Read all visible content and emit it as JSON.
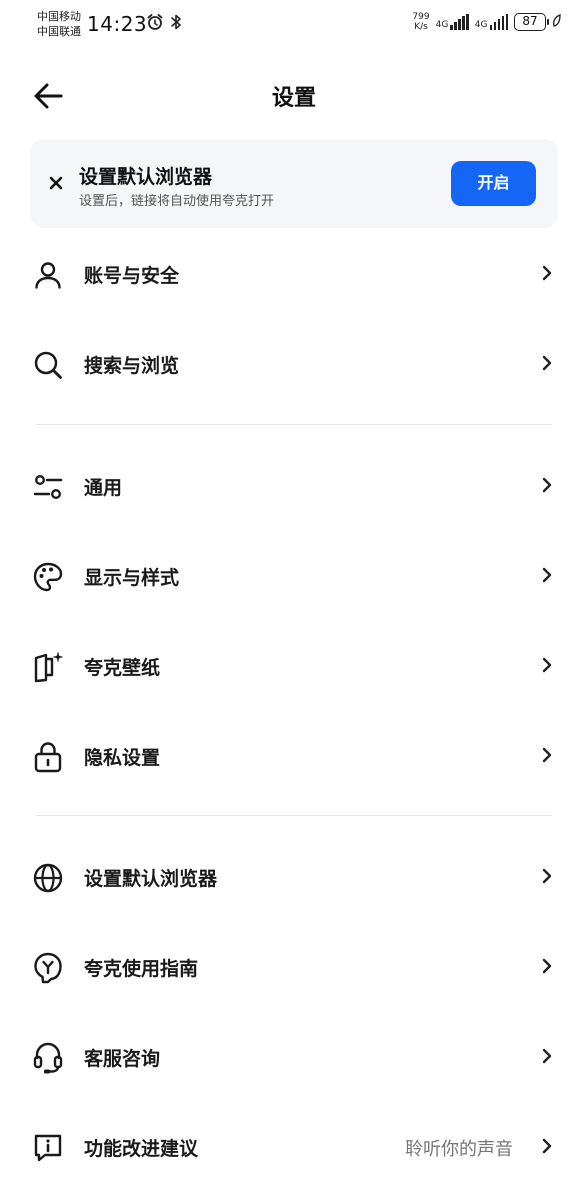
{
  "status_bar": {
    "carrier_1": "中国移动",
    "carrier_2": "中国联通",
    "time": "14:23",
    "speed_value": "799",
    "speed_unit": "K/s",
    "network_1": "4G",
    "network_2": "4G",
    "battery": "87"
  },
  "header": {
    "title": "设置"
  },
  "banner": {
    "title": "设置默认浏览器",
    "subtitle": "设置后，链接将自动使用夸克打开",
    "button_label": "开启"
  },
  "settings": {
    "groups": [
      {
        "items": [
          {
            "label": "账号与安全",
            "icon": "user-icon"
          },
          {
            "label": "搜索与浏览",
            "icon": "search-icon"
          }
        ]
      },
      {
        "items": [
          {
            "label": "通用",
            "icon": "sliders-icon"
          },
          {
            "label": "显示与样式",
            "icon": "palette-icon"
          },
          {
            "label": "夸克壁纸",
            "icon": "wallpaper-icon"
          },
          {
            "label": "隐私设置",
            "icon": "lock-icon"
          }
        ]
      },
      {
        "items": [
          {
            "label": "设置默认浏览器",
            "icon": "globe-icon"
          },
          {
            "label": "夸克使用指南",
            "icon": "guide-bulb-icon"
          },
          {
            "label": "客服咨询",
            "icon": "headset-icon"
          },
          {
            "label": "功能改进建议",
            "icon": "feedback-icon",
            "value": "聆听你的声音"
          }
        ]
      }
    ]
  }
}
